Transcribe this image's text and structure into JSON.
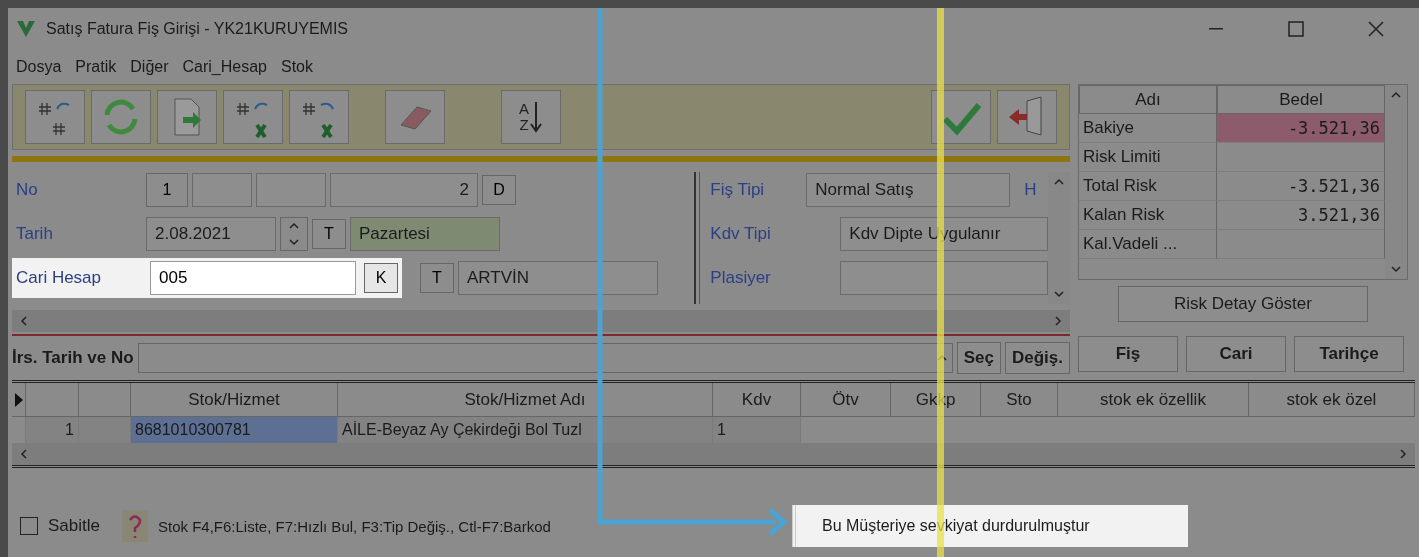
{
  "window": {
    "title": "Satış Fatura Fiş Girişi - YK21KURUYEMIS"
  },
  "menu": [
    "Dosya",
    "Pratik",
    "Diğer",
    "Cari_Hesap",
    "Stok"
  ],
  "sort_button": {
    "top": "A",
    "bottom": "Z"
  },
  "form": {
    "no": {
      "label": "No",
      "series": "1",
      "number": "2",
      "button": "D"
    },
    "tarih": {
      "label": "Tarih",
      "value": "2.08.2021",
      "button": "T",
      "day": "Pazartesi"
    },
    "cari": {
      "label": "Cari Hesap",
      "value": "005",
      "button": "K",
      "highlighted": true
    },
    "city": {
      "button": "T",
      "value": "ARTVİN"
    },
    "fis_tipi": {
      "label": "Fiş Tipi",
      "value": "Normal Satış"
    },
    "h_label": "H",
    "kdv_tipi": {
      "label": "Kdv Tipi",
      "value": "Kdv Dipte Uygulanır"
    },
    "plasiyer": {
      "label": "Plasiyer"
    }
  },
  "risk_table": {
    "columns": [
      "Adı",
      "Bedel"
    ],
    "rows": [
      {
        "name": "Bakiye",
        "value": "-3.521,36",
        "alert": true
      },
      {
        "name": "Risk Limiti",
        "alert": false
      },
      {
        "name": "Total Risk",
        "value": "-3.521,36",
        "alert": false
      },
      {
        "name": "Kalan Risk",
        "value": "3.521,36",
        "alert": false
      },
      {
        "name": "Kal.Vadeli ...",
        "alert": false
      }
    ]
  },
  "risk_button": "Risk Detay Göster",
  "side_buttons": [
    "Fiş",
    "Cari",
    "Tarihçe"
  ],
  "irs": {
    "label": "İrs. Tarih ve No",
    "buttons": [
      "Seç",
      "Değiş."
    ]
  },
  "grid": {
    "columns": [
      "Stok/Hizmet",
      "Stok/Hizmet Adı",
      "Kdv",
      "Ötv",
      "Gkkp",
      "Sto",
      "stok ek özellik",
      "stok ek özel"
    ],
    "rows": [
      {
        "no": "1",
        "cells": [
          "8681010300781",
          "AİLE-Beyaz Ay Çekirdeği Bol Tuzl",
          "1"
        ]
      }
    ]
  },
  "status": {
    "sabitle": {
      "label": "Sabitle",
      "checked": false
    },
    "hint": "Stok F4,F6:Liste, F7:Hızlı Bul, F3:Tip Değiş., Ctl-F7:Barkod",
    "message": "Bu Müşteriye sevkiyat durdurulmuştur",
    "message_highlighted": true
  }
}
